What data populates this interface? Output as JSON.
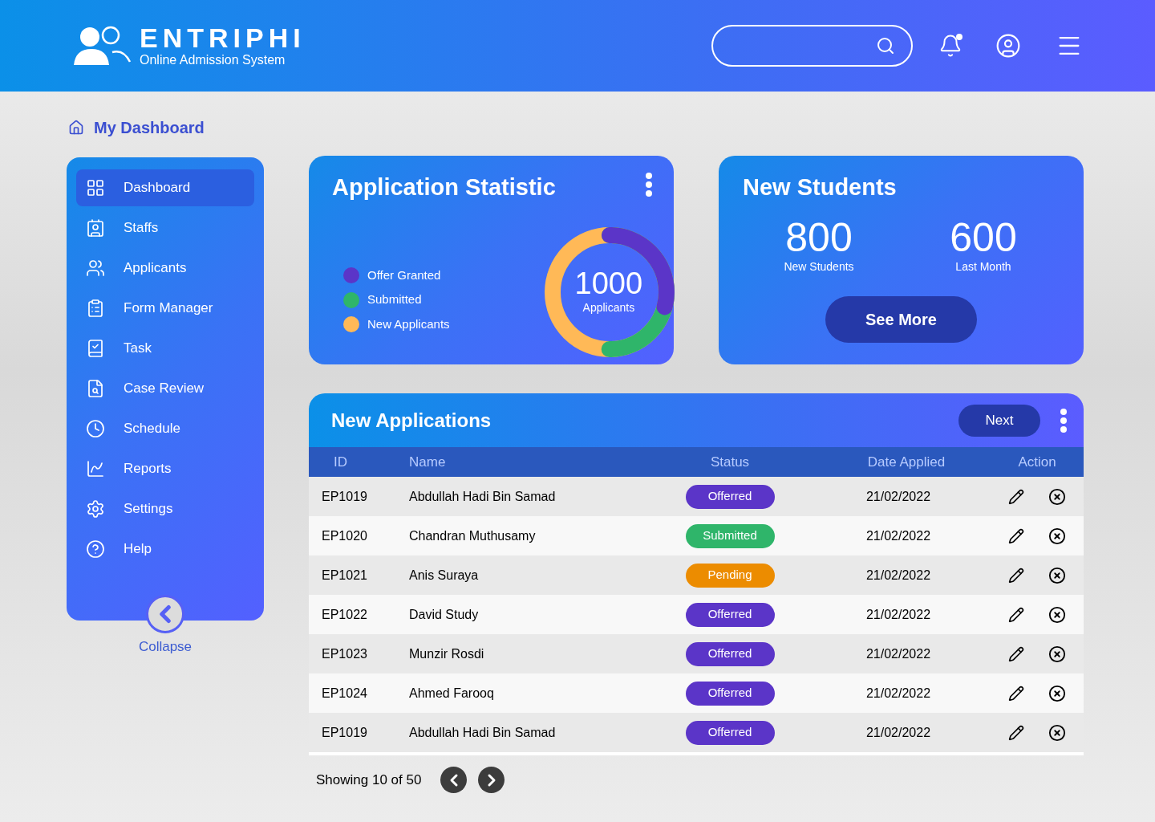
{
  "header": {
    "brand": "ENTRIPHI",
    "tagline": "Online Admission System",
    "notification_dot": true
  },
  "breadcrumb": "My Dashboard",
  "sidebar": {
    "items": [
      {
        "label": "Dashboard",
        "selected": true
      },
      {
        "label": "Staffs",
        "selected": false
      },
      {
        "label": "Applicants",
        "selected": false
      },
      {
        "label": "Form Manager",
        "selected": false
      },
      {
        "label": "Task",
        "selected": false
      },
      {
        "label": "Case Review",
        "selected": false
      },
      {
        "label": "Schedule",
        "selected": false
      },
      {
        "label": "Reports",
        "selected": false
      },
      {
        "label": "Settings",
        "selected": false
      },
      {
        "label": "Help",
        "selected": false
      }
    ],
    "collapse": "Collapse"
  },
  "statistic": {
    "title": "Application Statistic",
    "legend": [
      {
        "label": "Offer Granted",
        "color": "#5b35c8"
      },
      {
        "label": "Submitted",
        "color": "#2fb56a"
      },
      {
        "label": "New Applicants",
        "color": "#ffb957"
      }
    ],
    "total": "1000",
    "total_label": "Applicants"
  },
  "new_students": {
    "title": "New Students",
    "stats": [
      {
        "value": "800",
        "label": "New Students"
      },
      {
        "value": "600",
        "label": "Last Month"
      }
    ],
    "button": "See More"
  },
  "applications": {
    "title": "New Applications",
    "next": "Next",
    "columns": [
      "ID",
      "Name",
      "Status",
      "Date Applied",
      "Action"
    ],
    "rows": [
      {
        "id": "EP1019",
        "name": "Abdullah Hadi Bin Samad",
        "status": "Offerred",
        "color": "#5b35c8",
        "date": "21/02/2022"
      },
      {
        "id": "EP1020",
        "name": "Chandran Muthusamy",
        "status": "Submitted",
        "color": "#2fb56a",
        "date": "21/02/2022"
      },
      {
        "id": "EP1021",
        "name": "Anis Suraya",
        "status": "Pending",
        "color": "#ec8c00",
        "date": "21/02/2022"
      },
      {
        "id": "EP1022",
        "name": "David Study",
        "status": "Offerred",
        "color": "#5b35c8",
        "date": "21/02/2022"
      },
      {
        "id": "EP1023",
        "name": "Munzir Rosdi",
        "status": "Offerred",
        "color": "#5b35c8",
        "date": "21/02/2022"
      },
      {
        "id": "EP1024",
        "name": "Ahmed Farooq",
        "status": "Offerred",
        "color": "#5b35c8",
        "date": "21/02/2022"
      },
      {
        "id": "EP1019",
        "name": "Abdullah Hadi Bin Samad",
        "status": "Offerred",
        "color": "#5b35c8",
        "date": "21/02/2022"
      }
    ],
    "footer": "Showing 10 of 50"
  }
}
